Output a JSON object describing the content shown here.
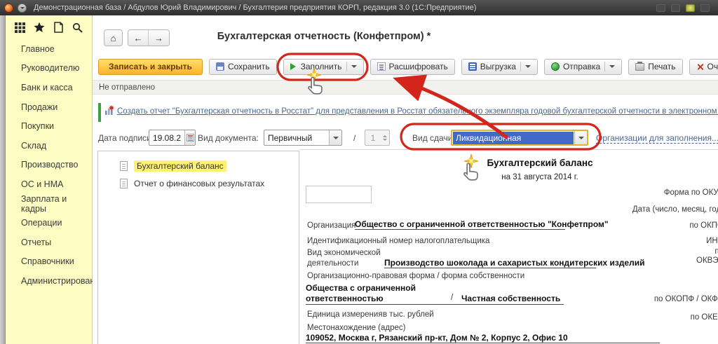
{
  "titlebar": {
    "title": "Демонстрационная база / Абдулов Юрий Владимирович / Бухгалтерия предприятия КОРП, редакция 3.0 (1С:Предприятие)"
  },
  "sidebar": {
    "items": [
      {
        "label": "Главное"
      },
      {
        "label": "Руководителю"
      },
      {
        "label": "Банк и касса"
      },
      {
        "label": "Продажи"
      },
      {
        "label": "Покупки"
      },
      {
        "label": "Склад"
      },
      {
        "label": "Производство"
      },
      {
        "label": "ОС и НМА"
      },
      {
        "label": "Зарплата и кадры"
      },
      {
        "label": "Операции"
      },
      {
        "label": "Отчеты"
      },
      {
        "label": "Справочники"
      },
      {
        "label": "Администрирование"
      }
    ]
  },
  "nav": {
    "home_icon": "⌂",
    "back_icon": "←",
    "forward_icon": "→",
    "page_title": "Бухгалтерская отчетность (Конфетпром) *"
  },
  "toolbar": {
    "buttons": [
      {
        "label": "Записать и закрыть"
      },
      {
        "label": "Сохранить"
      },
      {
        "label": "Заполнить"
      },
      {
        "label": "Расшифровать"
      },
      {
        "label": "Выгрузка"
      },
      {
        "label": "Отправка"
      },
      {
        "label": "Печать"
      },
      {
        "label": "Очистить"
      }
    ]
  },
  "status": {
    "text": "Не отправлено"
  },
  "notice": {
    "link_text": "Создать отчет \"Бухгалтерская отчетность в Росстат\" для представления в Росстат обязательного экземпляра годовой бухгалтерской отчетности в электронном виде."
  },
  "filters": {
    "date_label": "Дата подписи:",
    "date_value": "19.08.2",
    "doc_type_label": "Вид документа:",
    "doc_type_value": "Первичный",
    "separator": "/",
    "copy_number": "1",
    "report_kind_label": "Вид сдачи отчетности:",
    "report_kind_value": "Ликвидационная",
    "orgs_link": "Организации для заполнения..."
  },
  "tree": {
    "items": [
      {
        "label": "Бухгалтерский баланс"
      },
      {
        "label": "Отчет о финансовых результатах"
      }
    ]
  },
  "form": {
    "title": "Бухгалтерский баланс",
    "subtitle": "на 31 августа 2014 г.",
    "okud_label": "Форма по ОКУД",
    "date_label": "Дата (число, месяц, год)",
    "org_label": "Организация",
    "org_value": "Общество с ограниченной ответственностью \"Конфетпром\"",
    "okpo_label": "по ОКПО",
    "inn_label": "Идентификационный номер налогоплательщика",
    "inn_right": "ИНН",
    "activity_label_line1": "Вид экономической",
    "activity_label_line2": "деятельности",
    "activity_value": "Производство шоколада и сахаристых кондитерских изделий",
    "okved_line1": "по",
    "okved_line2": "ОКВЭД",
    "legal_form_label": "Организационно-правовая форма / форма собственности",
    "legal_form_line1": "Общества с ограниченной",
    "legal_form_line2": "ответственностью",
    "ownership_separator": "/",
    "ownership_value": "Частная собственность",
    "okopf_label": "по ОКОПФ / ОКФС",
    "unit_label": "Единица измерения:",
    "unit_value": "в тыс. рублей",
    "okei_label": "по ОКЕИ",
    "address_label": "Местонахождение (адрес)",
    "address_value": "109052, Москва г, Рязанский пр-кт, Дом № 2, Корпус 2, Офис 10"
  },
  "colors": {
    "annotation_red": "#d2261c",
    "primary_button": "#fdb22b",
    "sidebar_yellow": "#fcfcc3",
    "selection_blue": "#4169c8"
  }
}
